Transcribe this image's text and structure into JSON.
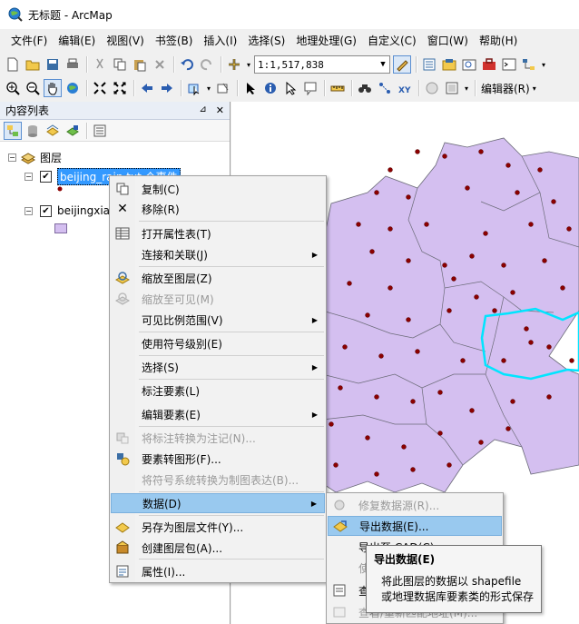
{
  "window": {
    "title": "无标题 - ArcMap"
  },
  "menu": [
    "文件(F)",
    "编辑(E)",
    "视图(V)",
    "书签(B)",
    "插入(I)",
    "选择(S)",
    "地理处理(G)",
    "自定义(C)",
    "窗口(W)",
    "帮助(H)"
  ],
  "toolbar": {
    "scale": "1:1,517,838",
    "editor_label": "编辑器(R)"
  },
  "toc": {
    "title": "内容列表",
    "pin": "⊿",
    "close": "✕",
    "group": "图层",
    "layers": [
      {
        "label": "beijing_rain.txt 个事件"
      },
      {
        "label": "beijingxia"
      }
    ]
  },
  "context_menu": {
    "items": [
      {
        "label": "复制(C)"
      },
      {
        "label": "移除(R)"
      },
      {
        "label": "打开属性表(T)"
      },
      {
        "label": "连接和关联(J)"
      },
      {
        "label": "缩放至图层(Z)"
      },
      {
        "label": "缩放至可见(M)"
      },
      {
        "label": "可见比例范围(V)"
      },
      {
        "label": "使用符号级别(E)"
      },
      {
        "label": "选择(S)"
      },
      {
        "label": "标注要素(L)"
      },
      {
        "label": "编辑要素(E)"
      },
      {
        "label": "将标注转换为注记(N)..."
      },
      {
        "label": "要素转图形(F)..."
      },
      {
        "label": "将符号系统转换为制图表达(B)..."
      },
      {
        "label": "数据(D)"
      },
      {
        "label": "另存为图层文件(Y)..."
      },
      {
        "label": "创建图层包(A)..."
      },
      {
        "label": "属性(I)..."
      }
    ]
  },
  "submenu": {
    "items": [
      {
        "label": "修复数据源(R)..."
      },
      {
        "label": "导出数据(E)..."
      },
      {
        "label": "导出至 CAD(C)..."
      },
      {
        "label": "使"
      },
      {
        "label": "查"
      },
      {
        "label": "查看/重新匹配地址(M)..."
      }
    ]
  },
  "tooltip": {
    "title": "导出数据(E)",
    "line1": "将此图层的数据以 shapefile",
    "line2": "或地理数据库要素类的形式保存"
  },
  "colors": {
    "polygon_fill": "#d4bff0",
    "highlight_outline": "#00e5ff",
    "point_fill": "#8b0000"
  }
}
